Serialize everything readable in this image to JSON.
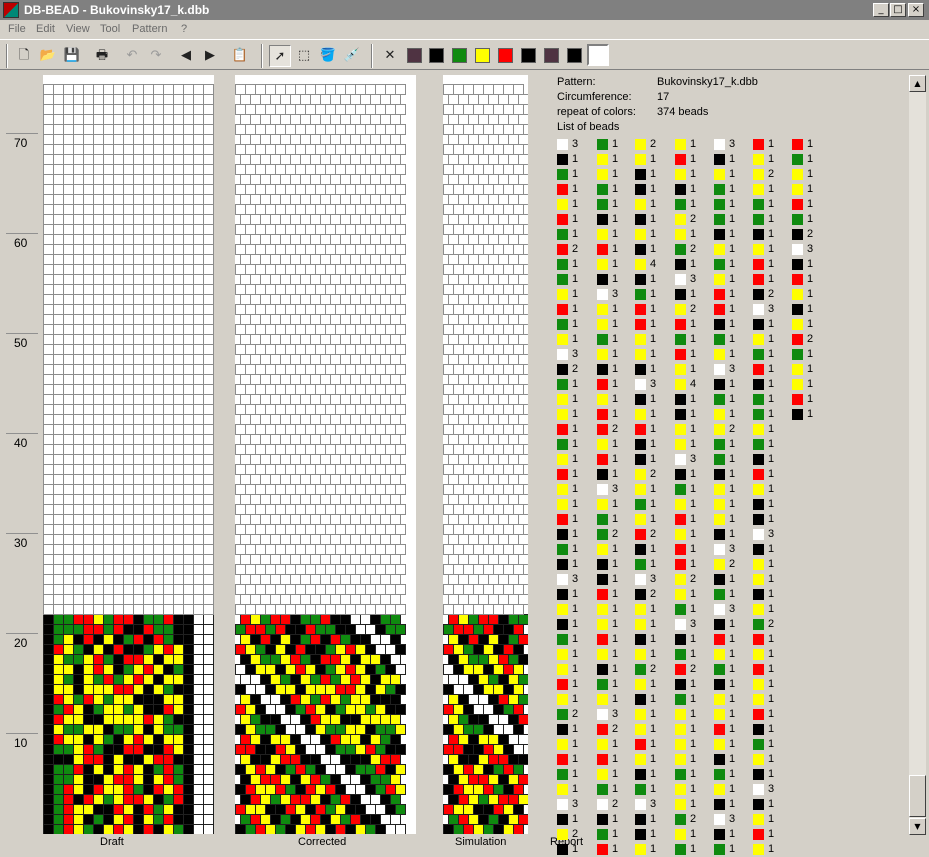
{
  "window": {
    "title": "DB-BEAD - Bukovinsky17_k.dbb",
    "minimize": "_",
    "maximize": "□",
    "close": "×"
  },
  "menu": [
    "File",
    "Edit",
    "View",
    "Tool",
    "Pattern",
    "?"
  ],
  "palette": {
    "swatches": [
      "#4f3342",
      "#000000",
      "#0f8a0f",
      "#ffff00",
      "#ff0000",
      "#000000",
      "#4f3342",
      "#000000",
      "#ffffff"
    ],
    "selected_index": 8
  },
  "ruler": [
    "70",
    "60",
    "50",
    "40",
    "30",
    "20",
    "10"
  ],
  "panels": {
    "draft": "Draft",
    "corrected": "Corrected",
    "simulation": "Simulation",
    "report": "Report"
  },
  "pattern_grid": {
    "width": 17,
    "total_rows": 75,
    "filled_rows": 22,
    "legend": {
      "W": "#ffffff",
      "K": "#000000",
      "G": "#0f8a0f",
      "Y": "#ffff00",
      "R": "#ff0000"
    },
    "rows": [
      "KGRYGKYRYKRKYGKWW",
      "KGRYKGKYRKYGRKKWW",
      "KGRYYKKRYKRGYKKWW",
      "KGRKRYGYRRYKGRKWW",
      "KGRYKRYYRGKRYRKWW",
      "KGGYKKYRRYKYRGKWW",
      "KGGRKYKYRYKGRGKWW",
      "KKKYRRKYKKYRRKKWW",
      "KGGYRGKKRRKKRYKWW",
      "KRYYKYGKYRYKYYKWW",
      "KYGGYYKGGYKYGGKWW",
      "KRYYKKYYYYRYGKKWW",
      "KGRYKGYYGYKKRYKWW",
      "KRYGRYGYYKKKYYKWW",
      "KYYKYYYRRYKYGKKWW",
      "KYGKYGRGYRYKYYKWW",
      "KYYKYRYKGYRYKGKWW",
      "KYGGYRGKRRYKYYKWW",
      "KRYGKYKRKKGYRYKWW",
      "KGYKRKYKGRKRGKKWW",
      "KGGGRRGRKKRGGKKWW",
      "KGGRRYGRRKGGRKKWW"
    ]
  },
  "report": {
    "pattern_label": "Pattern:",
    "pattern_value": "Bukovinsky17_k.dbb",
    "circ_label": "Circumference:",
    "circ_value": "17",
    "repeat_label": "repeat of colors:",
    "repeat_value": "374 beads",
    "list_label": "List of beads",
    "bead_colors": {
      "W": "#ffffff",
      "K": "#000000",
      "G": "#0f8a0f",
      "Y": "#ffff00",
      "R": "#ff0000"
    },
    "columns": [
      [
        "W3",
        "K1",
        "G1",
        "R1",
        "Y1",
        "R1",
        "G1",
        "R2",
        "G1",
        "G1",
        "Y1",
        "R1",
        "G1",
        "Y1",
        "W3",
        "K2",
        "G1",
        "Y1",
        "Y1",
        "R1",
        "G1",
        "Y1",
        "R1",
        "Y1",
        "Y1",
        "R1",
        "K1",
        "G1",
        "K1",
        "W3",
        "K1",
        "Y1",
        "K1",
        "G1",
        "Y1",
        "Y1",
        "R1",
        "Y1",
        "G2",
        "K1",
        "Y1",
        "R1",
        "G1",
        "Y1",
        "W3",
        "K1",
        "Y2",
        "K1"
      ],
      [
        "G1",
        "Y1",
        "Y1",
        "G1",
        "G1",
        "K1",
        "Y1",
        "R1",
        "Y1",
        "K1",
        "W3",
        "Y1",
        "Y1",
        "G1",
        "Y1",
        "K1",
        "R1",
        "Y1",
        "R1",
        "R2",
        "Y1",
        "R1",
        "K1",
        "W3",
        "Y1",
        "G1",
        "G2",
        "Y1",
        "K1",
        "K1",
        "R1",
        "Y1",
        "Y1",
        "R1",
        "Y1",
        "K1",
        "G1",
        "Y1",
        "W3",
        "R2",
        "Y1",
        "R1",
        "Y1",
        "G1",
        "W2",
        "K1",
        "G1",
        "R1"
      ],
      [
        "Y2",
        "Y1",
        "K1",
        "K1",
        "Y1",
        "K1",
        "Y1",
        "K1",
        "Y4",
        "K1",
        "G1",
        "R1",
        "R1",
        "Y1",
        "Y1",
        "K1",
        "W3",
        "K1",
        "Y1",
        "R1",
        "K1",
        "K1",
        "Y2",
        "Y1",
        "G1",
        "Y1",
        "R2",
        "K1",
        "G1",
        "W3",
        "K2",
        "Y1",
        "Y1",
        "K1",
        "Y1",
        "G2",
        "Y1",
        "K1",
        "Y1",
        "Y1",
        "R1",
        "Y1",
        "K1",
        "G1",
        "W3",
        "K1",
        "K1",
        "Y1"
      ],
      [
        "Y1",
        "R1",
        "Y1",
        "K1",
        "G1",
        "Y2",
        "Y1",
        "G2",
        "K1",
        "W3",
        "K1",
        "Y2",
        "R1",
        "G1",
        "R1",
        "Y1",
        "Y4",
        "K1",
        "K1",
        "Y1",
        "Y1",
        "W3",
        "K1",
        "G1",
        "Y1",
        "R1",
        "Y1",
        "R1",
        "R1",
        "Y2",
        "Y1",
        "G1",
        "W3",
        "K1",
        "G1",
        "R2",
        "K1",
        "G1",
        "Y1",
        "Y1",
        "Y1",
        "Y1",
        "G1",
        "Y1",
        "Y1",
        "G2",
        "Y1",
        "G1"
      ],
      [
        "W3",
        "K1",
        "Y1",
        "G1",
        "G1",
        "G1",
        "K1",
        "Y1",
        "G1",
        "Y1",
        "R1",
        "R1",
        "K1",
        "G1",
        "Y1",
        "W3",
        "K1",
        "G1",
        "Y1",
        "Y2",
        "G1",
        "G1",
        "K1",
        "Y1",
        "Y1",
        "Y1",
        "K1",
        "W3",
        "Y2",
        "K1",
        "G1",
        "W3",
        "K1",
        "R1",
        "Y1",
        "G1",
        "K1",
        "Y1",
        "Y1",
        "R1",
        "Y1",
        "K1",
        "G1",
        "Y1",
        "K1",
        "W3",
        "K1",
        "G1"
      ],
      [
        "R1",
        "Y1",
        "Y2",
        "Y1",
        "G1",
        "G1",
        "K1",
        "Y1",
        "R1",
        "R1",
        "K2",
        "W3",
        "K1",
        "Y1",
        "G1",
        "R1",
        "K1",
        "G1",
        "G1",
        "Y1",
        "G1",
        "K1",
        "R1",
        "Y1",
        "K1",
        "K1",
        "W3",
        "K1",
        "Y1",
        "Y1",
        "K1",
        "Y1",
        "G2",
        "R1",
        "Y1",
        "R1",
        "Y1",
        "Y1",
        "R1",
        "K1",
        "G1",
        "Y1",
        "K1",
        "W3",
        "K1",
        "Y1",
        "R1",
        "Y1"
      ],
      [
        "R1",
        "G1",
        "Y1",
        "Y1",
        "R1",
        "G1",
        "K2",
        "W3",
        "K1",
        "R1",
        "Y1",
        "K1",
        "Y1",
        "R2",
        "G1",
        "Y1",
        "Y1",
        "R1",
        "K1"
      ]
    ]
  }
}
